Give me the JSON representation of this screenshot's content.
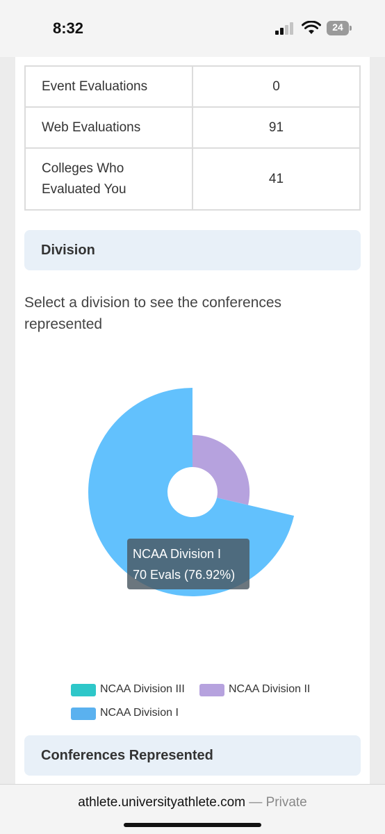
{
  "status_bar": {
    "time": "8:32",
    "battery": "24"
  },
  "stats_table": {
    "rows": [
      {
        "label": "Event Evaluations",
        "value": "0"
      },
      {
        "label": "Web Evaluations",
        "value": "91"
      },
      {
        "label": "Colleges Who Evaluated You",
        "value": "41"
      }
    ]
  },
  "division": {
    "header": "Division",
    "helper_text": "Select a division to see the conferences represented"
  },
  "chart_data": {
    "type": "pie",
    "variant": "polar-area",
    "title": "",
    "slices": [
      {
        "label": "NCAA Division III",
        "value": 0,
        "color": "#2ec7c9"
      },
      {
        "label": "NCAA Division II",
        "value": 21,
        "color": "#b6a2de"
      },
      {
        "label": "NCAA Division I",
        "value": 70,
        "color": "#5ab1ef"
      }
    ],
    "tooltip": {
      "title": "NCAA Division I",
      "text": "70 Evals (76.92%)"
    },
    "legend_position": "bottom"
  },
  "conferences": {
    "header": "Conferences Represented"
  },
  "browser": {
    "domain": "athlete.universityathlete.com",
    "separator": "—",
    "mode": "Private"
  },
  "colors": {
    "pie_division_1": "#62c1fd",
    "pie_division_2": "#b6a2de",
    "header_bg": "#e8f0f8"
  }
}
